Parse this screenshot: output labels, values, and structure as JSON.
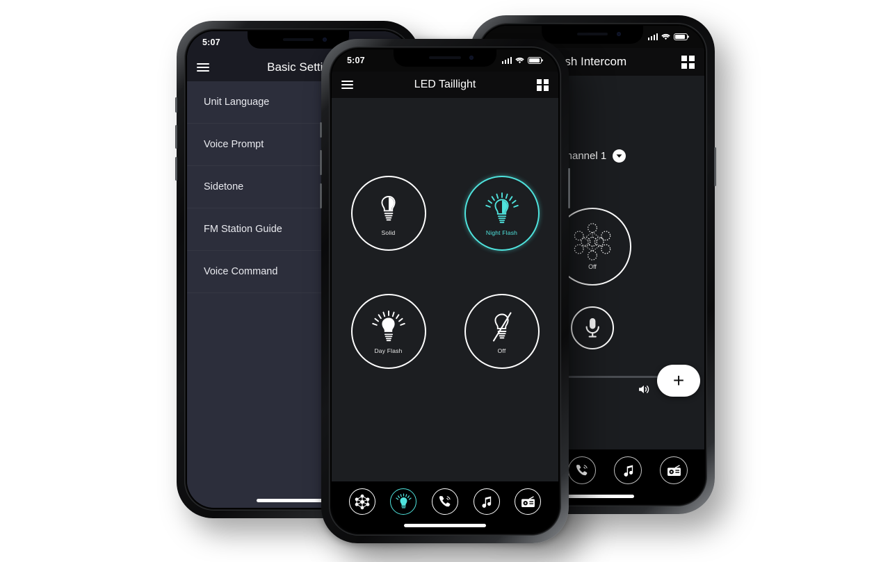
{
  "scene": {
    "description": "Three smartphone mockups showing a motorcycle headset companion app",
    "accent_cyan": "#4fe3dd",
    "page_background": "#ffffff"
  },
  "phone_left": {
    "status_bar": {
      "time": "5:07",
      "signal_icon": "cellular-bars-icon",
      "wifi_icon": "wifi-icon",
      "battery_icon": "battery-icon"
    },
    "nav": {
      "menu_icon": "hamburger-menu-icon",
      "title": "Basic Settin"
    },
    "list_items": [
      {
        "label": "Unit Language"
      },
      {
        "label": "Voice Prompt"
      },
      {
        "label": "Sidetone"
      },
      {
        "label": "FM Station Guide"
      },
      {
        "label": "Voice Command"
      }
    ]
  },
  "phone_center": {
    "status_bar": {
      "time": "5:07",
      "signal_icon": "cellular-bars-icon",
      "wifi_icon": "wifi-icon",
      "battery_icon": "battery-icon"
    },
    "nav": {
      "menu_icon": "hamburger-menu-icon",
      "title": "LED Taillight",
      "grid_icon": "grid-apps-icon"
    },
    "modes": [
      {
        "label": "Solid",
        "icon": "bulb-half-icon",
        "selected": false
      },
      {
        "label": "Night Flash",
        "icon": "bulb-rays-half-icon",
        "selected": true
      },
      {
        "label": "Day Flash",
        "icon": "bulb-rays-icon",
        "selected": false
      },
      {
        "label": "Off",
        "icon": "bulb-slash-icon",
        "selected": false
      }
    ],
    "tabs": [
      {
        "name": "mesh-intercom",
        "icon": "mesh-network-icon",
        "active": false
      },
      {
        "name": "led-taillight",
        "icon": "bulb-rays-icon",
        "active": true
      },
      {
        "name": "phone-call",
        "icon": "phone-call-icon",
        "active": false
      },
      {
        "name": "music",
        "icon": "music-note-icon",
        "active": false
      },
      {
        "name": "fm-radio",
        "icon": "radio-icon",
        "active": false
      }
    ]
  },
  "phone_right": {
    "status_bar": {
      "time": "",
      "signal_icon": "cellular-bars-icon",
      "wifi_icon": "wifi-icon",
      "battery_icon": "battery-icon"
    },
    "nav": {
      "menu_icon": "hamburger-menu-icon",
      "title": "esh Intercom",
      "grid_icon": "grid-apps-icon"
    },
    "channel": {
      "label": "Channel 1",
      "caret_icon": "chevron-down-icon"
    },
    "mesh_toggle": {
      "label": "Off",
      "icon": "mesh-network-icon"
    },
    "mic": {
      "icon": "microphone-icon"
    },
    "volume": {
      "value_percent": 8,
      "speaker_icon": "speaker-wave-icon"
    },
    "add_button": {
      "label": "+",
      "icon": "plus-icon"
    },
    "tabs": [
      {
        "name": "phone-call",
        "icon": "phone-call-icon",
        "active": false
      },
      {
        "name": "music",
        "icon": "music-note-icon",
        "active": false
      },
      {
        "name": "fm-radio",
        "icon": "radio-icon",
        "active": false
      }
    ]
  }
}
